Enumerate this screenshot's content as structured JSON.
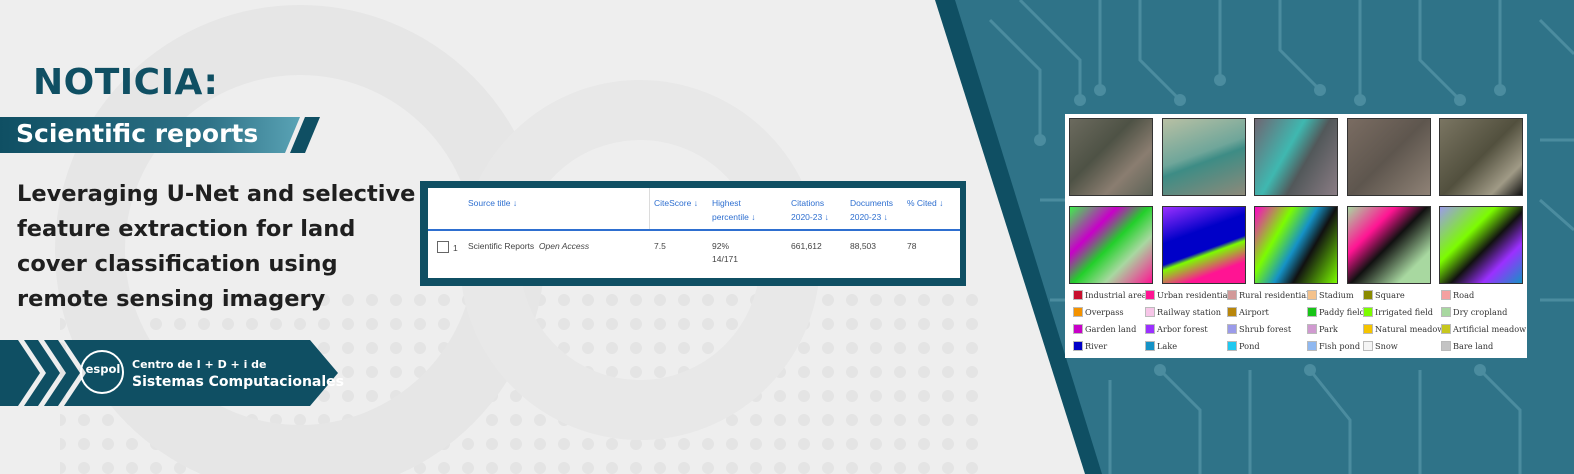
{
  "banner": {
    "heading": "NOTICIA:",
    "journal": "Scientific reports",
    "article_lines": [
      "Leveraging U-Net and selective",
      "feature extraction for land",
      "cover classification using",
      "remote sensing imagery"
    ],
    "colors": {
      "teal_dark": "#0f4f63",
      "teal_mid": "#2f7388",
      "accent_light": "#5aa3b5",
      "background": "#eeeeee"
    }
  },
  "center": {
    "logo_text": "espol",
    "line1": "Centro de I + D + i de",
    "line2": "Sistemas Computacionales"
  },
  "table": {
    "headers": {
      "source": "Source title",
      "citescore": "CiteScore",
      "percentile": [
        "Highest",
        "percentile"
      ],
      "citations": [
        "Citations",
        "2020-23"
      ],
      "documents": [
        "Documents",
        "2020-23"
      ],
      "cited": "% Cited"
    },
    "sort_icon": "arrow-down-icon",
    "row": {
      "index": "1",
      "title": "Scientific Reports",
      "access": "Open Access",
      "citescore": "7.5",
      "percentile": "92%",
      "rank": "14/171",
      "citations": "661,612",
      "documents": "88,503",
      "cited": "78"
    }
  },
  "figure": {
    "legend": [
      {
        "label": "Industrial area",
        "color": "#c8102e"
      },
      {
        "label": "Urban residential",
        "color": "#ff1493"
      },
      {
        "label": "Rural residential",
        "color": "#d29a9a"
      },
      {
        "label": "Stadium",
        "color": "#f4c28c"
      },
      {
        "label": "Square",
        "color": "#8a8a00"
      },
      {
        "label": "Road",
        "color": "#f5a0a0"
      },
      {
        "label": "Overpass",
        "color": "#f39200"
      },
      {
        "label": "Railway station",
        "color": "#f7c6e8"
      },
      {
        "label": "Airport",
        "color": "#b8860b"
      },
      {
        "label": "Paddy field",
        "color": "#18c418"
      },
      {
        "label": "Irrigated field",
        "color": "#7cfc00"
      },
      {
        "label": "Dry cropland",
        "color": "#a8d8a0"
      },
      {
        "label": "Garden land",
        "color": "#c800c8"
      },
      {
        "label": "Arbor forest",
        "color": "#9b30ff"
      },
      {
        "label": "Shrub forest",
        "color": "#9b9bea"
      },
      {
        "label": "Park",
        "color": "#d09ad0"
      },
      {
        "label": "Natural meadow",
        "color": "#f5c400"
      },
      {
        "label": "Artificial meadow",
        "color": "#c7c71e"
      },
      {
        "label": "River",
        "color": "#0000c8"
      },
      {
        "label": "Lake",
        "color": "#1592c6"
      },
      {
        "label": "Pond",
        "color": "#1fc8f0"
      },
      {
        "label": "Fish pond",
        "color": "#90b8f0"
      },
      {
        "label": "Snow",
        "color": "#f5f5f5"
      },
      {
        "label": "Bare land",
        "color": "#c4c4c4"
      }
    ]
  }
}
